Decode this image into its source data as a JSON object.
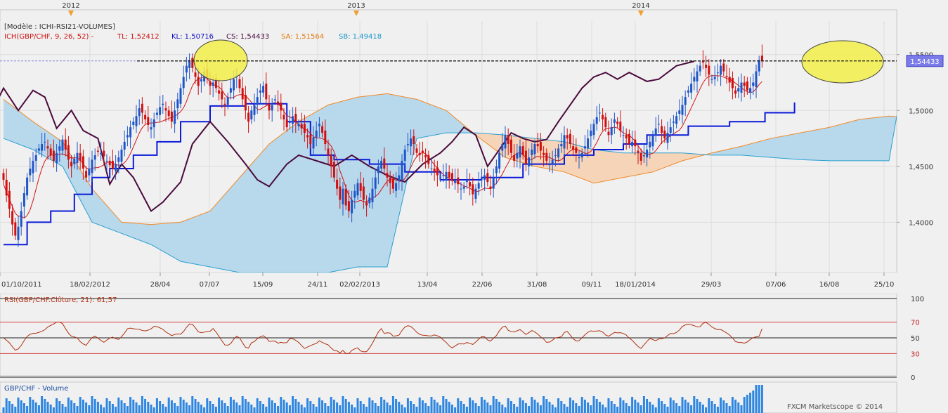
{
  "chart_data": {
    "type": "candlestick",
    "instrument": "GBP/CHF",
    "colors": {
      "up": "#1e56c9",
      "down": "#d01010",
      "tenkan": "#d41414",
      "kijun": "#0a1ad8",
      "chikou": "#4a0a3c",
      "cloud_bull": "#b8d8ec",
      "cloud_bear": "#f6d4b8",
      "senkou_a": "#f08a28",
      "senkou_b": "#2aa0d0",
      "rsi": "#b03010",
      "volume": "#2e86e0",
      "annotation": "#f2ee4a",
      "price_tag": "#7a7ae8"
    },
    "years": [
      "2012",
      "2013",
      "2014"
    ],
    "date_labels": [
      "01/10/2011",
      "18/02/2012",
      "28/04",
      "07/07",
      "15/09",
      "24/11",
      "02/02/2013",
      "13/04",
      "22/06",
      "31/08",
      "09/11",
      "18/01/2014",
      "29/03",
      "07/06",
      "16/08",
      "25/10"
    ],
    "price_axis": {
      "ticks": [
        "1,5500",
        "1,5000",
        "1,4500",
        "1,4000"
      ],
      "tick_values": [
        1.55,
        1.5,
        1.45,
        1.4
      ],
      "min": 1.355,
      "max": 1.58
    },
    "price_tag": "1,54433",
    "last_price": 1.54433,
    "legend_main": {
      "model": "[Modèle : ICHI-RSI21-VOLUMES]",
      "ich": "ICH(GBP/CHF, 9, 26, 52) -",
      "tl": "TL: 1,52412",
      "kl": "KL: 1,50716",
      "cs": "CS: 1,54433",
      "sa": "SA: 1,51564",
      "sb": "SB: 1,49418"
    },
    "rsi": {
      "legend": "RSI(GBP/CHF.Clôture, 21): 61,57",
      "axis_labels": [
        "100",
        "70",
        "50",
        "30",
        "0"
      ],
      "levels": [
        100,
        70,
        50,
        30,
        0
      ],
      "last": 61.57
    },
    "volume": {
      "legend": "GBP/CHF - Volume"
    },
    "watermark": "FXCM Marketscope © 2014",
    "closes": [
      1.438,
      1.424,
      1.412,
      1.398,
      1.388,
      1.396,
      1.41,
      1.426,
      1.44,
      1.448,
      1.455,
      1.46,
      1.466,
      1.47,
      1.472,
      1.466,
      1.46,
      1.455,
      1.462,
      1.468,
      1.474,
      1.465,
      1.456,
      1.45,
      1.457,
      1.462,
      1.455,
      1.448,
      1.44,
      1.448,
      1.456,
      1.46,
      1.463,
      1.462,
      1.459,
      1.455,
      1.451,
      1.448,
      1.452,
      1.458,
      1.465,
      1.472,
      1.478,
      1.485,
      1.49,
      1.495,
      1.502,
      1.498,
      1.492,
      1.487,
      1.485,
      1.492,
      1.498,
      1.503,
      1.506,
      1.5,
      1.495,
      1.49,
      1.5,
      1.51,
      1.52,
      1.53,
      1.54,
      1.545,
      1.538,
      1.53,
      1.522,
      1.528,
      1.535,
      1.53,
      1.522,
      1.525,
      1.52,
      1.515,
      1.51,
      1.505,
      1.512,
      1.52,
      1.528,
      1.532,
      1.52,
      1.51,
      1.5,
      1.49,
      1.5,
      1.505,
      1.512,
      1.518,
      1.522,
      1.51,
      1.5,
      1.505,
      1.51,
      1.505,
      1.5,
      1.492,
      1.485,
      1.49,
      1.495,
      1.49,
      1.488,
      1.484,
      1.48,
      1.476,
      1.47,
      1.476,
      1.482,
      1.488,
      1.48,
      1.47,
      1.46,
      1.45,
      1.44,
      1.43,
      1.42,
      1.43,
      1.415,
      1.41,
      1.42,
      1.428,
      1.435,
      1.428,
      1.42,
      1.415,
      1.422,
      1.43,
      1.44,
      1.45,
      1.455,
      1.448,
      1.44,
      1.435,
      1.43,
      1.435,
      1.442,
      1.455,
      1.465,
      1.47,
      1.475,
      1.47,
      1.462,
      1.46,
      1.462,
      1.458,
      1.452,
      1.448,
      1.445,
      1.442,
      1.44,
      1.442,
      1.445,
      1.44,
      1.437,
      1.438,
      1.434,
      1.43,
      1.432,
      1.438,
      1.432,
      1.425,
      1.43,
      1.435,
      1.44,
      1.442,
      1.436,
      1.43,
      1.44,
      1.45,
      1.462,
      1.47,
      1.478,
      1.47,
      1.462,
      1.455,
      1.462,
      1.468,
      1.46,
      1.452,
      1.458,
      1.465,
      1.47,
      1.468,
      1.464,
      1.46,
      1.455,
      1.452,
      1.456,
      1.46,
      1.466,
      1.47,
      1.478,
      1.475,
      1.47,
      1.465,
      1.462,
      1.458,
      1.462,
      1.468,
      1.475,
      1.482,
      1.488,
      1.494,
      1.498,
      1.492,
      1.485,
      1.478,
      1.485,
      1.492,
      1.488,
      1.482,
      1.478,
      1.475,
      1.47,
      1.472,
      1.468,
      1.462,
      1.455,
      1.46,
      1.465,
      1.472,
      1.478,
      1.484,
      1.488,
      1.48,
      1.475,
      1.48,
      1.485,
      1.49,
      1.495,
      1.5,
      1.505,
      1.512,
      1.518,
      1.524,
      1.53,
      1.535,
      1.54,
      1.543,
      1.538,
      1.532,
      1.528,
      1.53,
      1.534,
      1.54,
      1.535,
      1.53,
      1.525,
      1.52,
      1.515,
      1.52,
      1.525,
      1.522,
      1.518,
      1.52,
      1.525,
      1.535,
      1.545,
      1.54433
    ],
    "chikou_points": [
      [
        0,
        1.468
      ],
      [
        8,
        1.5
      ],
      [
        14,
        1.53
      ],
      [
        18,
        1.54
      ],
      [
        22,
        1.52
      ],
      [
        26,
        1.51
      ],
      [
        32,
        1.5
      ],
      [
        38,
        1.51
      ],
      [
        44,
        1.488
      ],
      [
        50,
        1.52
      ],
      [
        55,
        1.5
      ],
      [
        60,
        1.518
      ],
      [
        64,
        1.512
      ],
      [
        68,
        1.484
      ],
      [
        73,
        1.5
      ],
      [
        77,
        1.482
      ],
      [
        82,
        1.475
      ],
      [
        86,
        1.434
      ],
      [
        90,
        1.452
      ],
      [
        94,
        1.44
      ],
      [
        100,
        1.41
      ],
      [
        104,
        1.418
      ],
      [
        110,
        1.436
      ],
      [
        114,
        1.47
      ],
      [
        120,
        1.49
      ],
      [
        126,
        1.472
      ],
      [
        132,
        1.452
      ],
      [
        136,
        1.438
      ],
      [
        140,
        1.432
      ],
      [
        146,
        1.452
      ],
      [
        150,
        1.46
      ],
      [
        156,
        1.455
      ],
      [
        162,
        1.45
      ],
      [
        168,
        1.46
      ],
      [
        174,
        1.45
      ],
      [
        180,
        1.442
      ],
      [
        186,
        1.436
      ],
      [
        192,
        1.452
      ],
      [
        198,
        1.462
      ],
      [
        202,
        1.472
      ],
      [
        206,
        1.485
      ],
      [
        210,
        1.478
      ],
      [
        214,
        1.45
      ],
      [
        218,
        1.465
      ],
      [
        222,
        1.48
      ],
      [
        226,
        1.475
      ],
      [
        230,
        1.472
      ],
      [
        234,
        1.474
      ],
      [
        238,
        1.49
      ],
      [
        242,
        1.505
      ],
      [
        246,
        1.52
      ],
      [
        250,
        1.53
      ],
      [
        254,
        1.534
      ],
      [
        258,
        1.528
      ],
      [
        262,
        1.534
      ],
      [
        268,
        1.526
      ],
      [
        272,
        1.528
      ],
      [
        278,
        1.54
      ],
      [
        284,
        1.544
      ]
    ],
    "kijun_points": [
      [
        0,
        1.38
      ],
      [
        8,
        1.38
      ],
      [
        8,
        1.4
      ],
      [
        16,
        1.4
      ],
      [
        16,
        1.41
      ],
      [
        24,
        1.41
      ],
      [
        24,
        1.425
      ],
      [
        30,
        1.425
      ],
      [
        30,
        1.44
      ],
      [
        36,
        1.44
      ],
      [
        36,
        1.448
      ],
      [
        44,
        1.448
      ],
      [
        44,
        1.46
      ],
      [
        52,
        1.46
      ],
      [
        52,
        1.472
      ],
      [
        60,
        1.472
      ],
      [
        60,
        1.49
      ],
      [
        70,
        1.49
      ],
      [
        70,
        1.504
      ],
      [
        82,
        1.504
      ],
      [
        82,
        1.506
      ],
      [
        96,
        1.506
      ],
      [
        96,
        1.49
      ],
      [
        104,
        1.49
      ],
      [
        104,
        1.46
      ],
      [
        112,
        1.46
      ],
      [
        112,
        1.456
      ],
      [
        124,
        1.456
      ],
      [
        124,
        1.452
      ],
      [
        136,
        1.452
      ],
      [
        136,
        1.445
      ],
      [
        148,
        1.445
      ],
      [
        148,
        1.438
      ],
      [
        162,
        1.438
      ],
      [
        162,
        1.44
      ],
      [
        176,
        1.44
      ],
      [
        176,
        1.452
      ],
      [
        190,
        1.452
      ],
      [
        190,
        1.46
      ],
      [
        200,
        1.46
      ],
      [
        200,
        1.465
      ],
      [
        210,
        1.465
      ],
      [
        210,
        1.47
      ],
      [
        218,
        1.47
      ],
      [
        218,
        1.478
      ],
      [
        232,
        1.478
      ],
      [
        232,
        1.486
      ],
      [
        246,
        1.486
      ],
      [
        246,
        1.49
      ],
      [
        258,
        1.49
      ],
      [
        258,
        1.498
      ],
      [
        268,
        1.498
      ],
      [
        268,
        1.50716
      ]
    ],
    "cloud_points": [
      [
        0,
        1.51,
        1.475
      ],
      [
        10,
        1.49,
        1.465
      ],
      [
        20,
        1.472,
        1.45
      ],
      [
        30,
        1.43,
        1.4
      ],
      [
        40,
        1.4,
        1.39
      ],
      [
        50,
        1.398,
        1.38
      ],
      [
        60,
        1.4,
        1.365
      ],
      [
        70,
        1.41,
        1.36
      ],
      [
        80,
        1.44,
        1.355
      ],
      [
        90,
        1.47,
        1.355
      ],
      [
        100,
        1.49,
        1.355
      ],
      [
        110,
        1.505,
        1.355
      ],
      [
        120,
        1.512,
        1.36
      ],
      [
        130,
        1.515,
        1.36
      ],
      [
        140,
        1.51,
        1.475
      ],
      [
        150,
        1.5,
        1.48
      ],
      [
        160,
        1.478,
        1.48
      ],
      [
        170,
        1.458,
        1.478
      ],
      [
        180,
        1.45,
        1.475
      ],
      [
        190,
        1.445,
        1.472
      ],
      [
        200,
        1.435,
        1.465
      ],
      [
        210,
        1.44,
        1.462
      ],
      [
        220,
        1.445,
        1.462
      ],
      [
        230,
        1.455,
        1.462
      ],
      [
        240,
        1.462,
        1.46
      ],
      [
        250,
        1.468,
        1.46
      ],
      [
        260,
        1.475,
        1.458
      ],
      [
        270,
        1.48,
        1.456
      ],
      [
        280,
        1.485,
        1.455
      ],
      [
        290,
        1.492,
        1.455
      ],
      [
        300,
        1.495,
        1.455
      ],
      [
        304,
        1.49418,
        1.51564
      ]
    ]
  }
}
